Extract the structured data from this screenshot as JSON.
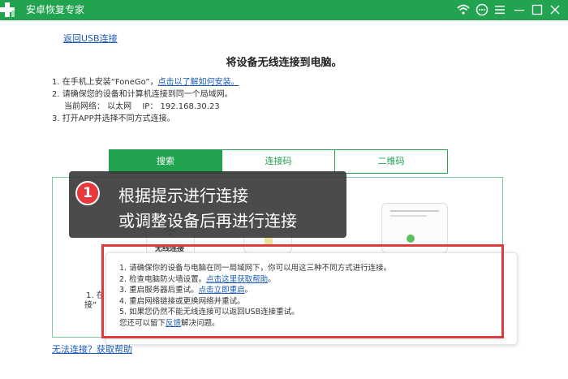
{
  "app": {
    "title": "安卓恢复专家"
  },
  "nav": {
    "back_link": "返回USB连接"
  },
  "page": {
    "title": "将设备无线连接到电脑。"
  },
  "steps": {
    "s1_text": "1. 在手机上安装“FoneGo”，",
    "s1_link": "点击以了解如何安装。",
    "s2_text": "2. 请确保您的设备和计算机连接到同一个局域网。",
    "s2_network": "当前网络： 以太网　 IP： 192.168.30.23",
    "s3_text": "3. 打开APP并选择不同方式连接。"
  },
  "tabs": [
    {
      "label": "搜索",
      "active": true
    },
    {
      "label": "连接码",
      "active": false
    },
    {
      "label": "二维码",
      "active": false
    }
  ],
  "background": {
    "wifi_label": "无线连接",
    "partial_step": "1. 在",
    "partial_quote": "接”"
  },
  "tooltip": {
    "number": "1",
    "line1": "根据提示进行连接",
    "line2": "或调整设备后再进行连接"
  },
  "help": {
    "item1": "1.  请确保你的设备与电脑在同一局域网下，你可以用这三种不同方式进行连接。",
    "item2_text": "2.  检查电脑防火墙设置。",
    "item2_link": "点击这里获取帮助",
    "item2_end": "。",
    "item3_text": "3.  重启服务器后重试。",
    "item3_link": "点击立即重启",
    "item3_end": "。",
    "item4": "4.  重启网络链接或更换网络并重试。",
    "item5": "5.  如果您仍然不能无线连接可以返回USB连接重试。",
    "feedback_pre": "您还可以留下",
    "feedback_link": "反馈",
    "feedback_post": "解决问题。"
  },
  "footer": {
    "help_link": "无法连接？获取帮助"
  },
  "colors": {
    "brand": "#21a350",
    "alert": "#e03a3c",
    "link": "#1a5bb5"
  },
  "icons": [
    "app-logo-icon",
    "wifi-icon",
    "chat-icon",
    "menu-icon",
    "minimize-icon",
    "maximize-icon",
    "close-icon"
  ]
}
